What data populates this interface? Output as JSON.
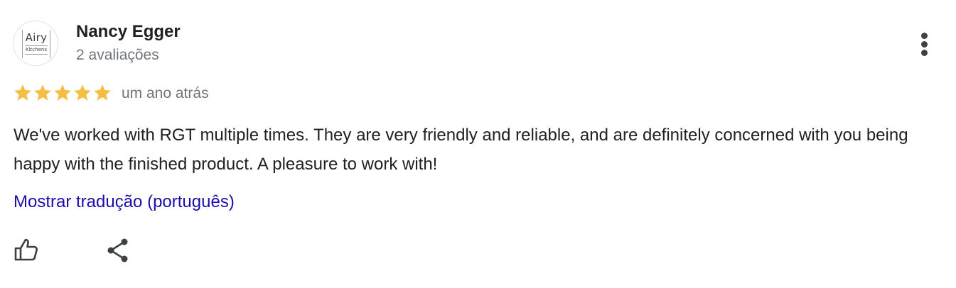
{
  "reviewer": {
    "name": "Nancy Egger",
    "review_count": "2 avaliações",
    "avatar": {
      "logo_line1": "Airy",
      "logo_line2": "Kitchens"
    }
  },
  "rating": {
    "value": 5,
    "max": 5,
    "star_color": "#f4bf42"
  },
  "review": {
    "time": "um ano atrás",
    "text": "We've worked with RGT multiple times. They are very friendly and reliable, and are definitely concerned with you being happy with the finished product. A pleasure to work with!",
    "translate_link": "Mostrar tradução (português)"
  },
  "actions": {
    "like_icon": "thumbs-up-icon",
    "share_icon": "share-icon",
    "more_icon": "more-vert-icon"
  },
  "colors": {
    "link": "#1a0dab",
    "secondary_text": "#70757a",
    "primary_text": "#202124"
  }
}
